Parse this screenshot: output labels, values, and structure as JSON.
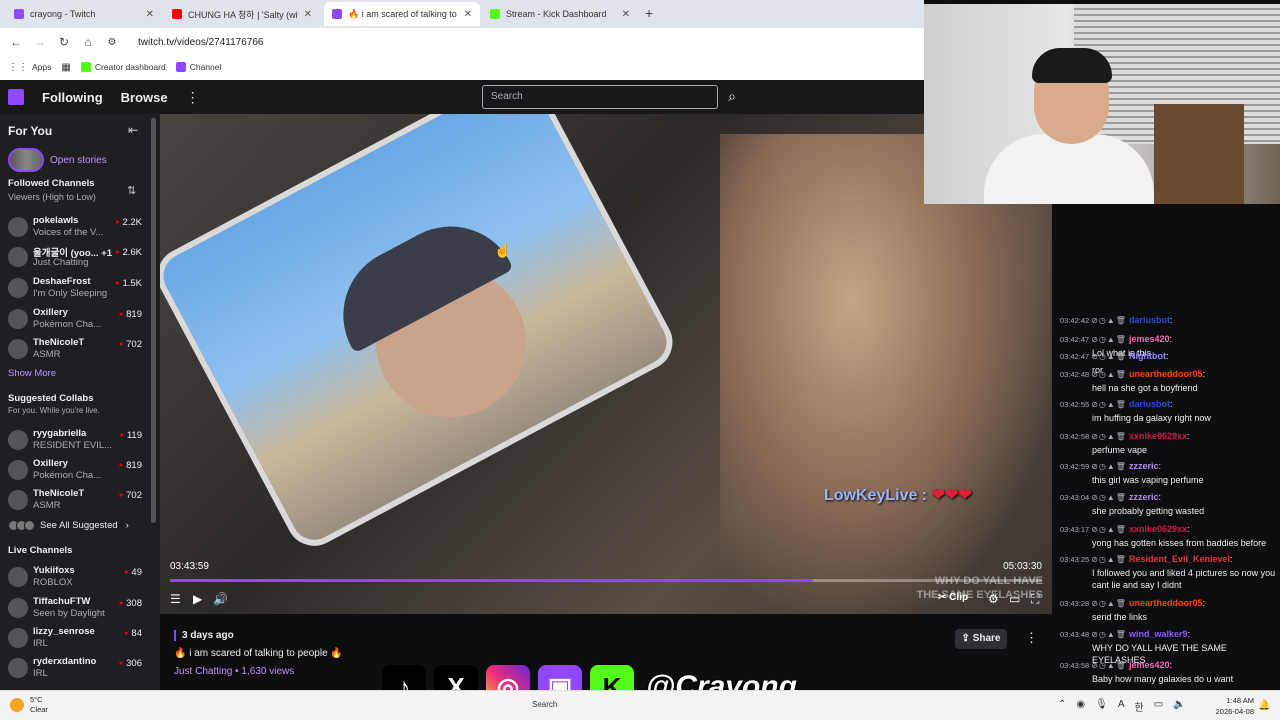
{
  "browser": {
    "tabs": [
      {
        "title": "crayong - Twitch",
        "color": "#9147ff",
        "active": false
      },
      {
        "title": "CHUNG HA 청하 | 'Salty (with",
        "color": "#ff0000",
        "active": false
      },
      {
        "title": "🔥 i am scared of talking to peo",
        "color": "#9147ff",
        "active": true
      },
      {
        "title": "Stream - Kick Dashboard",
        "color": "#53fc18",
        "active": false
      }
    ],
    "new_tab": "+",
    "url": "twitch.tv/videos/2741176766",
    "bookmarks": [
      {
        "label": "Apps"
      },
      {
        "label": "Creator dashboard"
      },
      {
        "label": "Channel"
      }
    ]
  },
  "twitch": {
    "nav": {
      "following": "Following",
      "browse": "Browse",
      "search_placeholder": "Search"
    },
    "sidebar": {
      "for_you": "For You",
      "open_stories": "Open stories",
      "followed_title": "Followed Channels",
      "followed_sub": "Viewers (High to Low)",
      "followed": [
        {
          "name": "pokelawls",
          "game": "Voices of the V...",
          "viewers": "2.2K"
        },
        {
          "name": "울개굴이 (yoo... +1",
          "game": "Just Chatting",
          "viewers": "2.6K"
        },
        {
          "name": "DeshaeFrost",
          "game": "I'm Only Sleeping",
          "viewers": "1.5K"
        },
        {
          "name": "Oxillery",
          "game": "Pokémon Cha...",
          "viewers": "819"
        },
        {
          "name": "TheNicoleT",
          "game": "ASMR",
          "viewers": "702"
        }
      ],
      "show_more": "Show More",
      "suggested_title": "Suggested Collabs",
      "suggested_sub": "For you. While you're live.",
      "suggested": [
        {
          "name": "ryygabriella",
          "game": "RESIDENT EVIL...",
          "viewers": "119"
        },
        {
          "name": "Oxillery",
          "game": "Pokémon Cha...",
          "viewers": "819"
        },
        {
          "name": "TheNicoleT",
          "game": "ASMR",
          "viewers": "702"
        }
      ],
      "see_all": "See All Suggested",
      "live_title": "Live Channels",
      "live": [
        {
          "name": "Yukiifoxs",
          "game": "ROBLOX",
          "viewers": "49"
        },
        {
          "name": "TiffachuFTW",
          "game": "Seen by Daylight",
          "viewers": "308"
        },
        {
          "name": "lizzy_senrose",
          "game": "IRL",
          "viewers": "84"
        },
        {
          "name": "ryderxdantino",
          "game": "IRL",
          "viewers": "306"
        }
      ]
    },
    "video": {
      "overlay_name": "LowKeyLive :",
      "overlay_hearts": "❤❤❤",
      "caption_line1": "WHY DO YALL HAVE",
      "caption_line2": "THE SAME EYELASHES",
      "elapsed": "03:43:59",
      "duration": "05:03:30",
      "progress": 0.737,
      "clip_label": "Clip"
    },
    "info": {
      "ago": "3 days ago",
      "title": "🔥 i am scared of talking to people 🔥",
      "category": "Just Chatting",
      "views": " • 1,630 views",
      "share": "Share"
    }
  },
  "chat": [
    {
      "ts": "03:42:42",
      "user": "dariusbot",
      "color": "#2e4bd6",
      "text": ""
    },
    {
      "ts": "03:42:47",
      "user": "jemes420",
      "color": "#ff69b4",
      "text": "Lol what is this"
    },
    {
      "ts": "03:42:47",
      "user": "Nightbot",
      "color": "#8a8aff",
      "text": "ror"
    },
    {
      "ts": "03:42:48",
      "user": "uneartheddoor05",
      "color": "#ff4500",
      "text": "hell na she got a boyfriend"
    },
    {
      "ts": "03:42:55",
      "user": "dariusbot",
      "color": "#2e4bd6",
      "text": "im huffing da galaxy right now"
    },
    {
      "ts": "03:42:58",
      "user": "xxnike0629xx",
      "color": "#d01c45",
      "text": "perfume vape"
    },
    {
      "ts": "03:42:59",
      "user": "zzzeric",
      "color": "#b28cff",
      "text": "this girl was vaping perfume"
    },
    {
      "ts": "03:43:04",
      "user": "zzzeric",
      "color": "#b28cff",
      "text": "she probably getting wasted"
    },
    {
      "ts": "03:43:17",
      "user": "xxnike0629xx",
      "color": "#d01c45",
      "text": "yong has gotten kisses from baddies before"
    },
    {
      "ts": "03:43:25",
      "user": "Resident_Evil_Kenievel",
      "color": "#e03a3a",
      "text": "I followed you and liked 4 pictures so now you cant lie and say I didnt"
    },
    {
      "ts": "03:43:28",
      "user": "uneartheddoor05",
      "color": "#ff4500",
      "text": "send the links"
    },
    {
      "ts": "03:43:48",
      "user": "wind_walker9",
      "color": "#8a5cff",
      "text": "WHY DO YALL HAVE THE SAME EYELASHES"
    },
    {
      "ts": "03:43:58",
      "user": "jemes420",
      "color": "#ff69b4",
      "text": "Baby how many galaxies do u want"
    }
  ],
  "socials": {
    "handle": "@Crayong"
  },
  "taskbar": {
    "temp": "5°C",
    "condition": "Clear",
    "search": "Search",
    "time": "1:48 AM",
    "date": "2026-04-08"
  }
}
